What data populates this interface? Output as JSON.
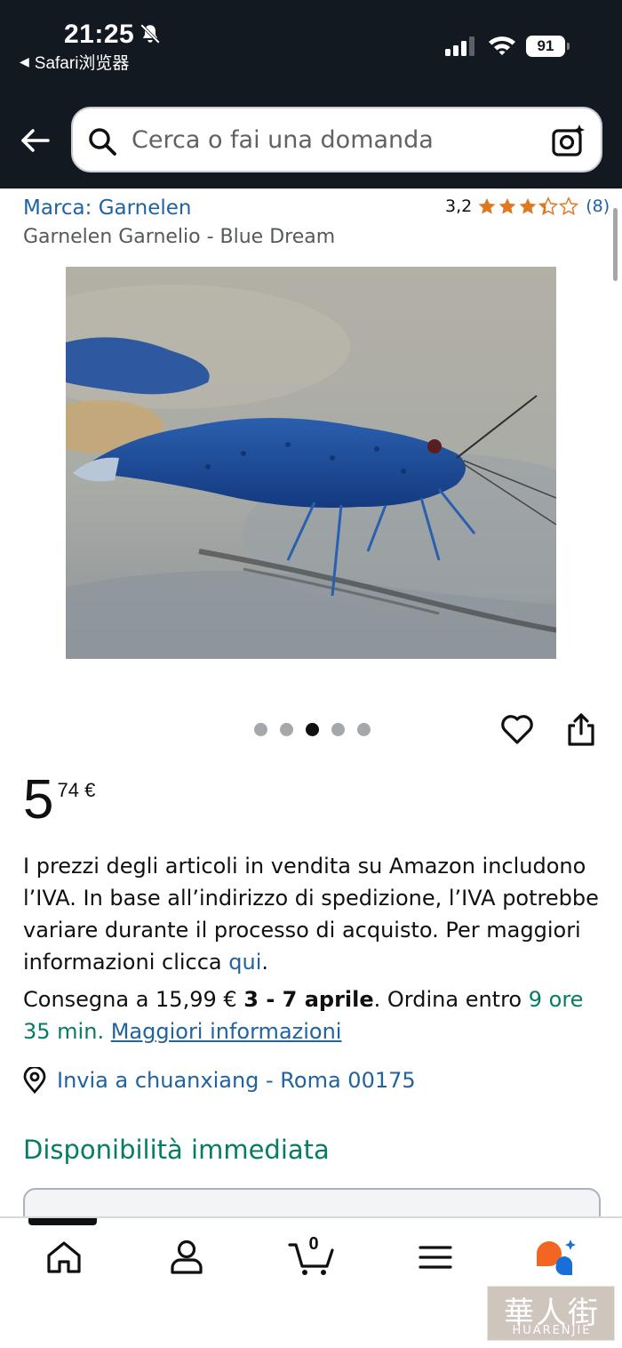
{
  "status_bar": {
    "time": "21:25",
    "back_app": "Safari浏览器",
    "battery": "91"
  },
  "search": {
    "placeholder": "Cerca o fai una domanda"
  },
  "product": {
    "brand": "Marca: Garnelen",
    "rating_value": "3,2",
    "rating_stars": 3.2,
    "rating_count": "(8)",
    "title": "Garnelen Garnelio - Blue Dream",
    "image_alt": "blue shrimp photo",
    "carousel_total": 5,
    "carousel_active": 3
  },
  "price": {
    "whole": "5",
    "fraction": "74 €"
  },
  "vat": {
    "text": "I prezzi degli articoli in vendita su Amazon includono l’IVA. In base all’indirizzo di spedizione, l’IVA potrebbe variare durante il processo di acquisto. Per maggiori informazioni clicca ",
    "link": "qui",
    "end": "."
  },
  "delivery": {
    "prefix": "Consegna a 15,99 € ",
    "dates": "3 - 7 aprile",
    "order_by": ". Ordina entro ",
    "countdown": "9 ore 35 min",
    "sep": ". ",
    "more_link": "Maggiori informazioni"
  },
  "ship_to": "Invia a chuanxiang - Roma 00175",
  "availability": "Disponibilità immediata",
  "bottom_nav": {
    "cart_count": "0",
    "items": [
      "home-icon",
      "account-icon",
      "cart-icon",
      "menu-icon",
      "rufus-icon"
    ]
  },
  "watermark": {
    "cn": "華人街",
    "en": "HUARENJIE"
  },
  "colors": {
    "header_bg": "#131921",
    "link": "#2162a1",
    "green": "#067d62",
    "star": "#de7921"
  }
}
